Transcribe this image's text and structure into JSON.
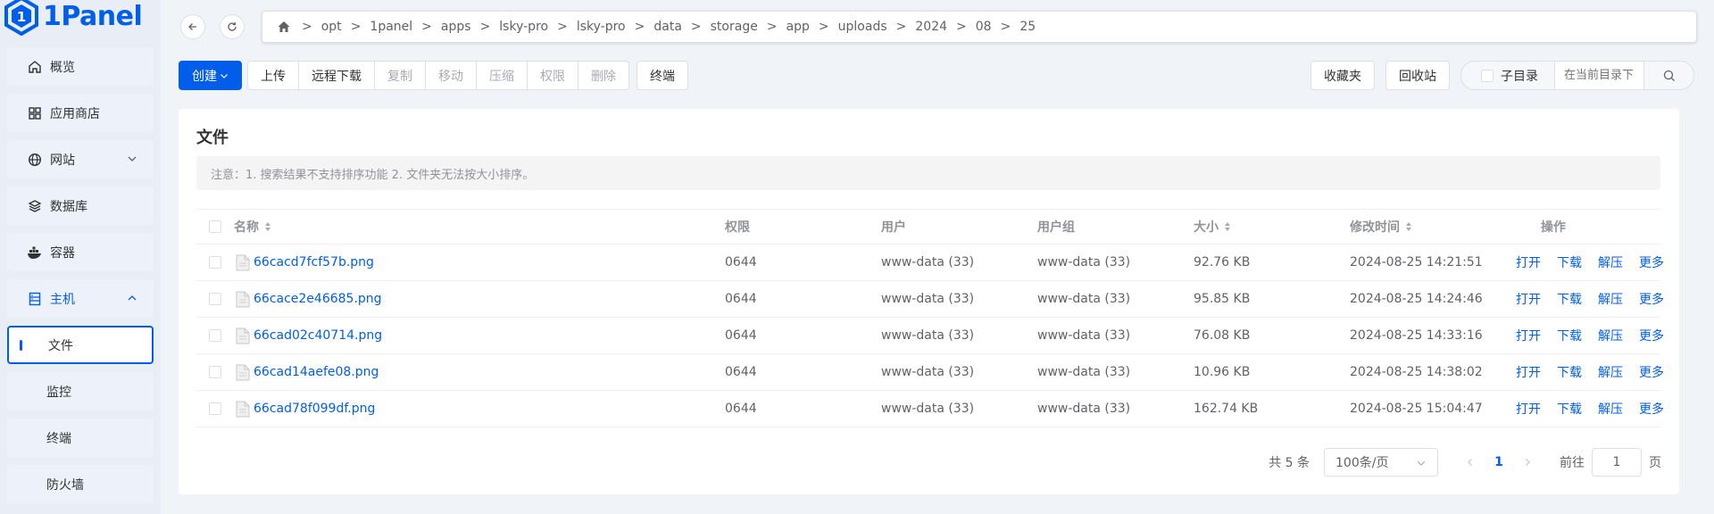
{
  "app": {
    "logo_text": "1Panel"
  },
  "sidebar": {
    "items": [
      {
        "label": "概览",
        "icon": "home-icon"
      },
      {
        "label": "应用商店",
        "icon": "grid-icon"
      },
      {
        "label": "网站",
        "icon": "globe-icon"
      },
      {
        "label": "数据库",
        "icon": "layers-icon"
      },
      {
        "label": "容器",
        "icon": "docker-icon"
      },
      {
        "label": "主机",
        "icon": "server-icon"
      }
    ],
    "sub_items": [
      {
        "label": "文件",
        "active": true
      },
      {
        "label": "监控"
      },
      {
        "label": "终端"
      },
      {
        "label": "防火墙"
      }
    ]
  },
  "path": {
    "segments": [
      "opt",
      "1panel",
      "apps",
      "lsky-pro",
      "lsky-pro",
      "data",
      "storage",
      "app",
      "uploads",
      "2024",
      "08",
      "25"
    ],
    "separator": ">"
  },
  "toolbar": {
    "create": "创建",
    "upload": "上传",
    "remote_download": "远程下载",
    "copy": "复制",
    "move": "移动",
    "compress": "压缩",
    "permission": "权限",
    "delete": "删除",
    "terminal": "终端",
    "favorites": "收藏夹",
    "recycle_bin": "回收站",
    "subdir": "子目录",
    "search_placeholder": "在当前目录下"
  },
  "card": {
    "title": "文件",
    "notice": "注意：1. 搜索结果不支持排序功能 2. 文件夹无法按大小排序。"
  },
  "table": {
    "headers": {
      "name": "名称",
      "permission": "权限",
      "user": "用户",
      "group": "用户组",
      "size": "大小",
      "modified": "修改时间",
      "actions": "操作"
    },
    "rows": [
      {
        "name": "66cacd7fcf57b.png",
        "perm": "0644",
        "user": "www-data (33)",
        "group": "www-data (33)",
        "size": "92.76 KB",
        "modified": "2024-08-25 14:21:51"
      },
      {
        "name": "66cace2e46685.png",
        "perm": "0644",
        "user": "www-data (33)",
        "group": "www-data (33)",
        "size": "95.85 KB",
        "modified": "2024-08-25 14:24:46"
      },
      {
        "name": "66cad02c40714.png",
        "perm": "0644",
        "user": "www-data (33)",
        "group": "www-data (33)",
        "size": "76.08 KB",
        "modified": "2024-08-25 14:33:16"
      },
      {
        "name": "66cad14aefe08.png",
        "perm": "0644",
        "user": "www-data (33)",
        "group": "www-data (33)",
        "size": "10.96 KB",
        "modified": "2024-08-25 14:38:02"
      },
      {
        "name": "66cad78f099df.png",
        "perm": "0644",
        "user": "www-data (33)",
        "group": "www-data (33)",
        "size": "162.74 KB",
        "modified": "2024-08-25 15:04:47"
      }
    ],
    "row_actions": {
      "open": "打开",
      "download": "下载",
      "extract": "解压",
      "more": "更多"
    }
  },
  "pagination": {
    "total": "共 5 条",
    "page_size": "100条/页",
    "current_page": "1",
    "goto_label": "前往",
    "goto_value": "1",
    "page_suffix": "页"
  },
  "colors": {
    "primary": "#005eeb"
  }
}
